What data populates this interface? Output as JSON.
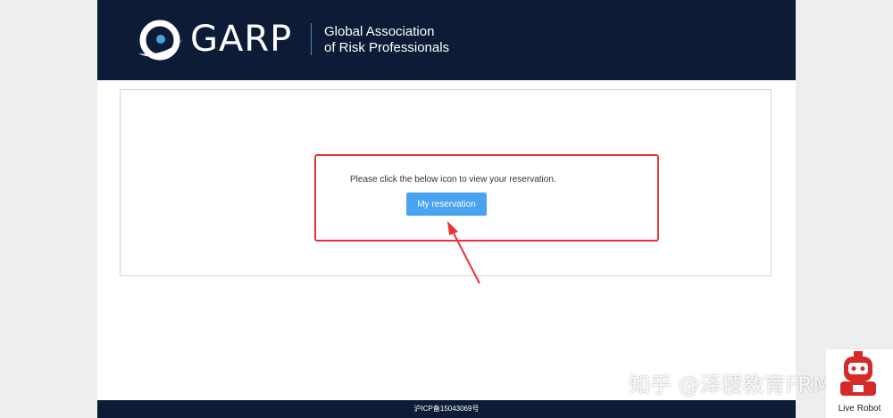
{
  "header": {
    "logo_text": "GARP",
    "tagline_line1": "Global Association",
    "tagline_line2": "of Risk Professionals"
  },
  "main": {
    "message": "Please click the below icon to view your reservation.",
    "reservation_button": "My reservation"
  },
  "footer": {
    "icp": "沪ICP备15043069号"
  },
  "watermark": {
    "text": "知乎 @泽稷教育FRM"
  },
  "robot_widget": {
    "label": "Live Robot"
  },
  "colors": {
    "header_bg": "#0d1b36",
    "button_bg": "#4aa3f0",
    "highlight": "#e8323a"
  }
}
